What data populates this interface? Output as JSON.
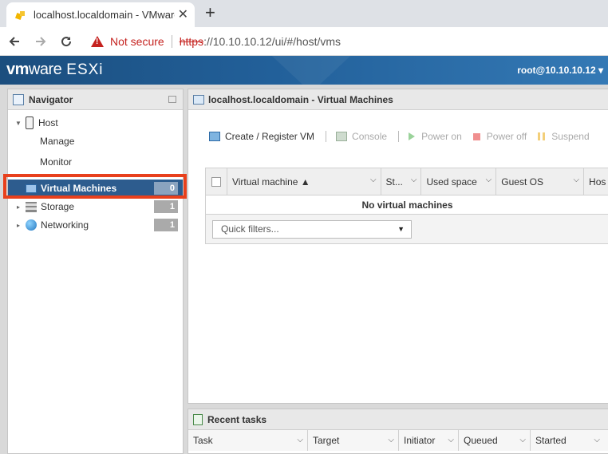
{
  "browser": {
    "tab_title": "localhost.localdomain - VMware ESXi",
    "tab_close": "✕",
    "new_tab": "+",
    "security_label": "Not secure",
    "url_scheme": "https",
    "url_rest": "://10.10.10.12/ui/#/host/vms"
  },
  "header": {
    "logo_vm": "vm",
    "logo_ware": "ware",
    "logo_esxi": "ESXi",
    "user": "root@10.10.10.12 ▾"
  },
  "navigator": {
    "title": "Navigator",
    "items": [
      {
        "label": "Host"
      },
      {
        "label": "Manage"
      },
      {
        "label": "Monitor"
      },
      {
        "label": "Virtual Machines",
        "badge": "0"
      },
      {
        "label": "Storage",
        "badge": "1"
      },
      {
        "label": "Networking",
        "badge": "1"
      }
    ]
  },
  "main": {
    "title": "localhost.localdomain - Virtual Machines",
    "actions": {
      "create": "Create / Register VM",
      "console": "Console",
      "power_on": "Power on",
      "power_off": "Power off",
      "suspend": "Suspend"
    },
    "columns": [
      "Virtual machine ▲",
      "St...",
      "Used space",
      "Guest OS",
      "Hos"
    ],
    "empty_message": "No virtual machines",
    "quick_filters": "Quick filters..."
  },
  "tasks": {
    "title": "Recent tasks",
    "columns": [
      "Task",
      "Target",
      "Initiator",
      "Queued",
      "Started"
    ]
  }
}
